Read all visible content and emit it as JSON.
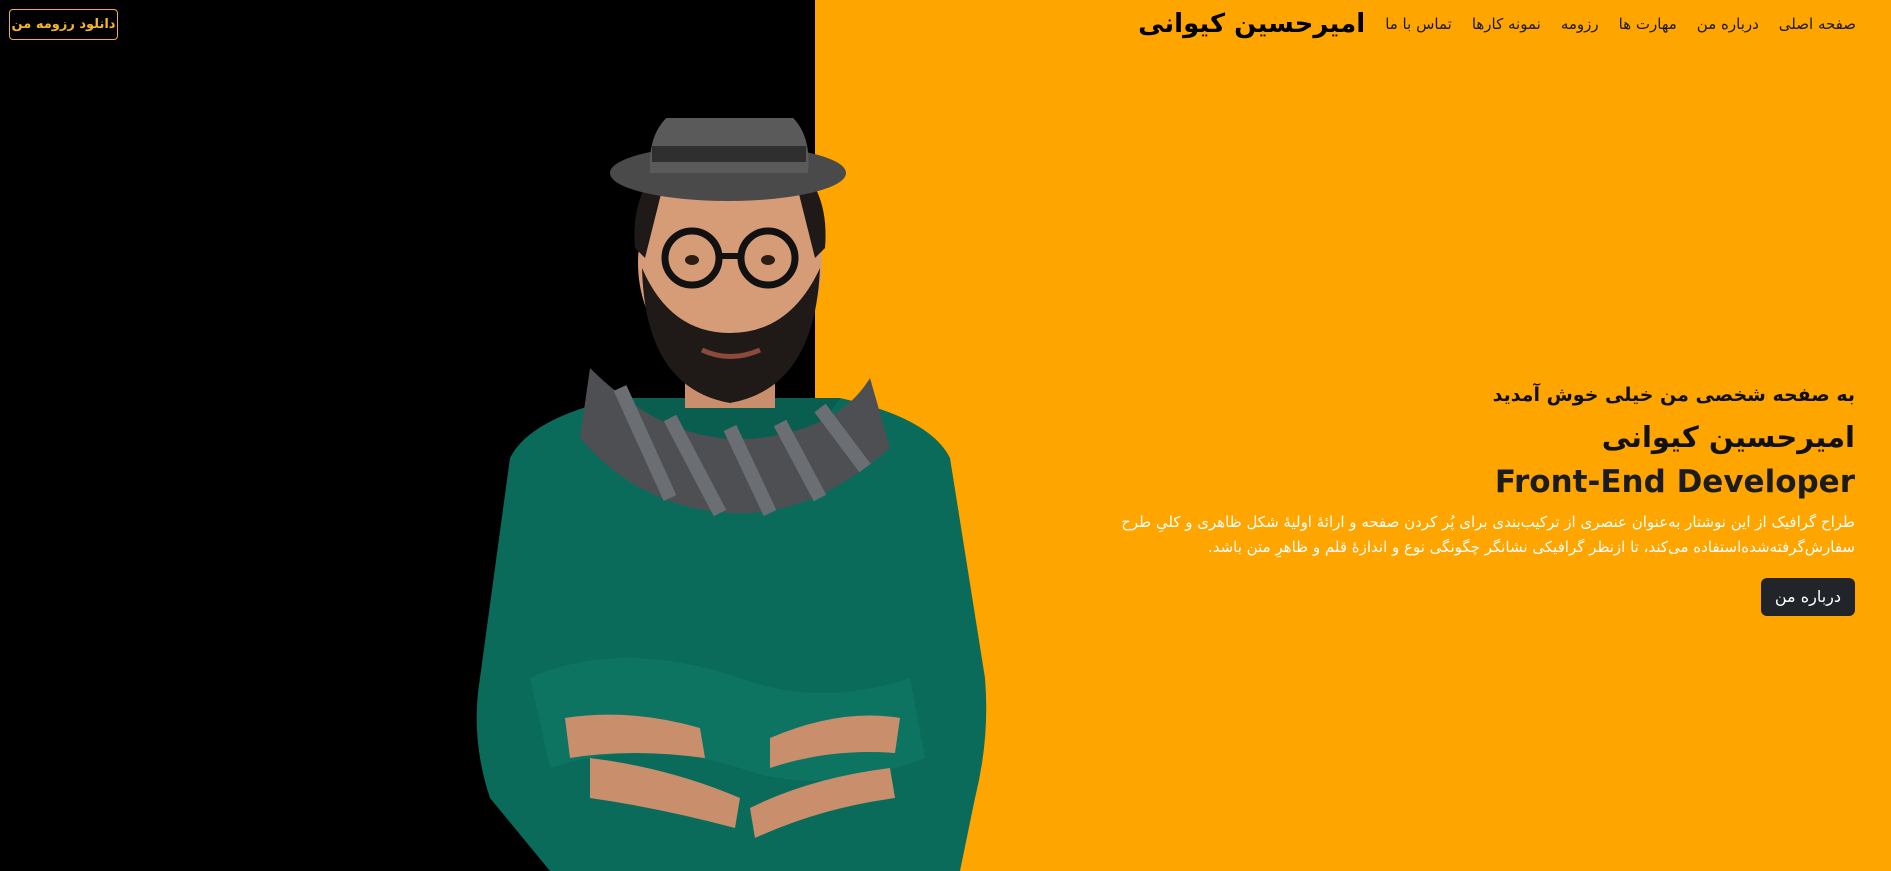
{
  "nav": {
    "brand": "امیرحسین کیوانی",
    "links": [
      "صفحه اصلی",
      "درباره من",
      "مهارت ها",
      "رزومه",
      "نمونه کارها",
      "تماس با ما"
    ]
  },
  "resume_button": "دانلود رزومه من",
  "hero": {
    "welcome": "به صفحه شخصی من خیلی خوش آمدید",
    "name": "امیرحسین کیوانی",
    "role": "Front-End Developer",
    "description": "طراح گرافیک از این نوشتار به‌عنوان عنصری از ترکیب‌بندی برای پُر کردن صفحه و ارائهٔ اولیهٔ شکل ظاهری و کلیِ طرح سفارش‌گرفته‌شده‌استفاده می‌کند، تا ازنظر گرافیکی نشانگر چگونگی نوع و اندازهٔ قلم و ظاهرِ متن باشد.",
    "button": "درباره من"
  },
  "colors": {
    "accent": "#ffa500",
    "dark": "#000000",
    "button": "#212529",
    "resume_border": "#f3b12a"
  },
  "hero_image": "person-portrait-photo"
}
